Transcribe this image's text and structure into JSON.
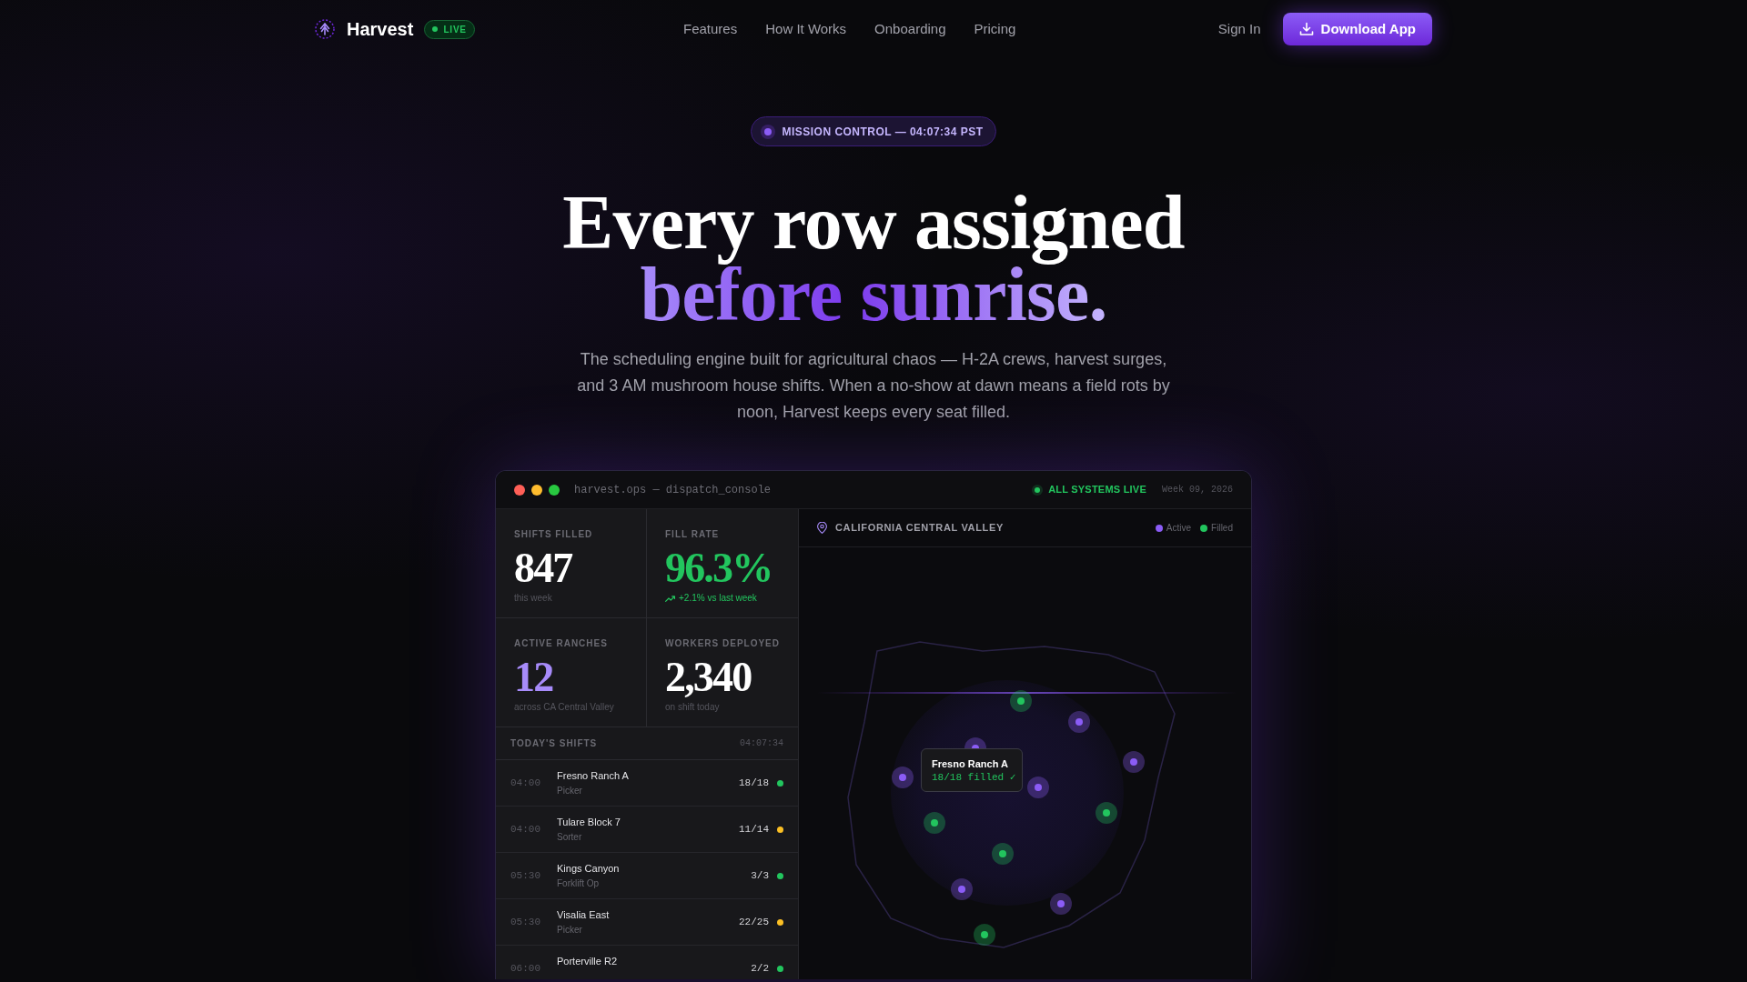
{
  "nav": {
    "brand": "Harvest",
    "badge": "LIVE",
    "links": [
      "Features",
      "How It Works",
      "Onboarding",
      "Pricing"
    ],
    "sign_in": "Sign In",
    "cta": "Download App"
  },
  "hero": {
    "eyebrow": "MISSION CONTROL — 04:07:34 PST",
    "title": "Every row assigned",
    "title_accent": "before sunrise.",
    "lead": "The scheduling engine built for agricultural chaos — H-2A crews, harvest surges, and 3 AM mushroom house shifts. When a no-show at dawn means a field rots by noon, Harvest keeps every seat filled."
  },
  "console": {
    "title": "harvest.ops — dispatch_console",
    "status": "ALL SYSTEMS LIVE",
    "week": "Week 09, 2026",
    "stats": [
      {
        "label": "SHIFTS FILLED",
        "value": "847",
        "note": "this week",
        "kind": "plain"
      },
      {
        "label": "FILL RATE",
        "value": "96.3%",
        "note": "+2.1% vs last week",
        "kind": "positive"
      },
      {
        "label": "ACTIVE RANCHES",
        "value": "12",
        "note": "across CA Central Valley",
        "kind": "accent"
      },
      {
        "label": "WORKERS DEPLOYED",
        "value": "2,340",
        "note": "on shift today",
        "kind": "plain"
      }
    ],
    "shifts": {
      "title": "TODAY'S SHIFTS",
      "time": "04:07:34",
      "rows": [
        {
          "time": "04:00",
          "site": "Fresno Ranch A",
          "role": "Picker",
          "count": "18/18",
          "color": "#22c55e"
        },
        {
          "time": "04:00",
          "site": "Tulare Block 7",
          "role": "Sorter",
          "count": "11/14",
          "color": "#fbbf24"
        },
        {
          "time": "05:30",
          "site": "Kings Canyon",
          "role": "Forklift Op",
          "count": "3/3",
          "color": "#22c55e"
        },
        {
          "time": "05:30",
          "site": "Visalia East",
          "role": "Picker",
          "count": "22/25",
          "color": "#fbbf24"
        },
        {
          "time": "06:00",
          "site": "Porterville R2",
          "count": "2/2",
          "color": "#22c55e"
        }
      ]
    },
    "map": {
      "title": "CALIFORNIA CENTRAL VALLEY",
      "legend": [
        {
          "label": "Active",
          "color": "#8b5cf6"
        },
        {
          "label": "Filled",
          "color": "#22c55e"
        }
      ],
      "markers": [
        {
          "color": "#22c55e"
        },
        {
          "color": "#8b5cf6"
        },
        {
          "color": "#8b5cf6"
        },
        {
          "color": "#8b5cf6"
        },
        {
          "color": "#8b5cf6"
        },
        {
          "color": "#8b5cf6"
        },
        {
          "color": "#22c55e"
        },
        {
          "color": "#22c55e"
        },
        {
          "color": "#22c55e"
        },
        {
          "color": "#8b5cf6"
        },
        {
          "color": "#8b5cf6"
        },
        {
          "color": "#22c55e"
        }
      ],
      "tooltip": {
        "title": "Fresno Ranch A",
        "detail": "18/18 filled ✓"
      }
    }
  }
}
